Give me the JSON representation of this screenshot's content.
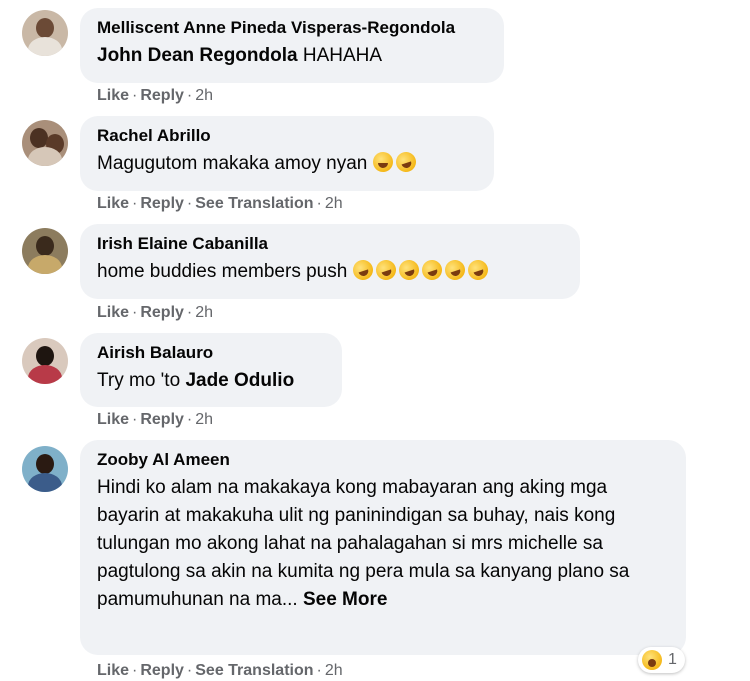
{
  "comments": [
    {
      "author": "Melliscent Anne Pineda Visperas-Regondola",
      "text_mention": "John Dean Regondola",
      "text": " HAHAHA",
      "actions": {
        "like": "Like",
        "reply": "Reply",
        "time": "2h"
      }
    },
    {
      "author": "Rachel Abrillo",
      "text": "Magugutom makaka amoy nyan",
      "emojis": [
        "grinning-face",
        "rofl-face"
      ],
      "actions": {
        "like": "Like",
        "reply": "Reply",
        "translate": "See Translation",
        "time": "2h"
      }
    },
    {
      "author": "Irish Elaine Cabanilla",
      "text": "home buddies members push",
      "emojis": [
        "rofl-face",
        "rofl-face",
        "rofl-face",
        "rofl-face",
        "rofl-face",
        "rofl-face"
      ],
      "actions": {
        "like": "Like",
        "reply": "Reply",
        "time": "2h"
      }
    },
    {
      "author": "Airish Balauro",
      "text": "Try mo 'to ",
      "text_mention": "Jade Odulio",
      "actions": {
        "like": "Like",
        "reply": "Reply",
        "time": "2h"
      }
    },
    {
      "author": "Zooby Al Ameen",
      "text": "Hindi ko alam na makakaya kong mabayaran ang aking mga bayarin at makakuha ulit ng paninindigan sa buhay, nais kong tulungan mo akong lahat na pahalagahan si mrs michelle sa pagtulong sa akin na kumita ng pera mula sa kanyang plano sa pamumuhunan na ma... ",
      "see_more": "See More",
      "actions": {
        "like": "Like",
        "reply": "Reply",
        "translate": "See Translation",
        "time": "2h"
      },
      "reaction": {
        "icon": "haha-reaction-icon",
        "count": "1"
      }
    }
  ],
  "separator": "·",
  "colors": {
    "bubble": "#f0f2f5",
    "meta": "#65676b",
    "text": "#050505"
  }
}
